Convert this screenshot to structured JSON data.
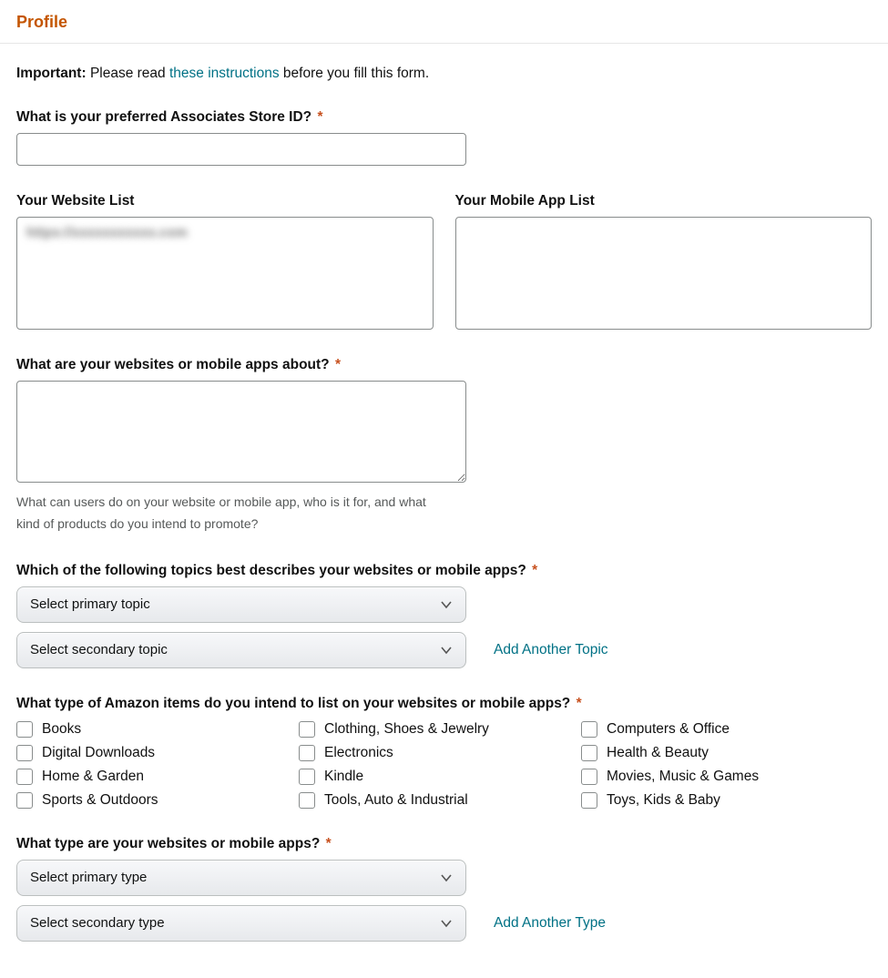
{
  "header": {
    "title": "Profile"
  },
  "intro": {
    "importantLabel": "Important:",
    "preText": " Please read ",
    "linkText": "these instructions",
    "postText": " before you fill this form."
  },
  "storeId": {
    "label": "What is your preferred Associates Store ID?",
    "required": "*",
    "value": ""
  },
  "websiteList": {
    "label": "Your Website List",
    "redactedValue": "https://xxxxxxxxxxx.com"
  },
  "mobileAppList": {
    "label": "Your Mobile App List",
    "value": ""
  },
  "about": {
    "label": "What are your websites or mobile apps about?",
    "required": "*",
    "value": "",
    "help": "What can users do on your website or mobile app, who is it for, and what kind of products do you intend to promote?"
  },
  "topics": {
    "label": "Which of the following topics best describes your websites or mobile apps?",
    "required": "*",
    "primaryPlaceholder": "Select primary topic",
    "secondaryPlaceholder": "Select secondary topic",
    "addAnother": "Add Another Topic"
  },
  "itemTypes": {
    "label": "What type of Amazon items do you intend to list on your websites or mobile apps?",
    "required": "*",
    "options": [
      "Books",
      "Clothing, Shoes & Jewelry",
      "Computers & Office",
      "Digital Downloads",
      "Electronics",
      "Health & Beauty",
      "Home & Garden",
      "Kindle",
      "Movies, Music & Games",
      "Sports & Outdoors",
      "Tools, Auto & Industrial",
      "Toys, Kids & Baby"
    ]
  },
  "siteTypes": {
    "label": "What type are your websites or mobile apps?",
    "required": "*",
    "primaryPlaceholder": "Select primary type",
    "secondaryPlaceholder": "Select secondary type",
    "addAnother": "Add Another Type"
  }
}
